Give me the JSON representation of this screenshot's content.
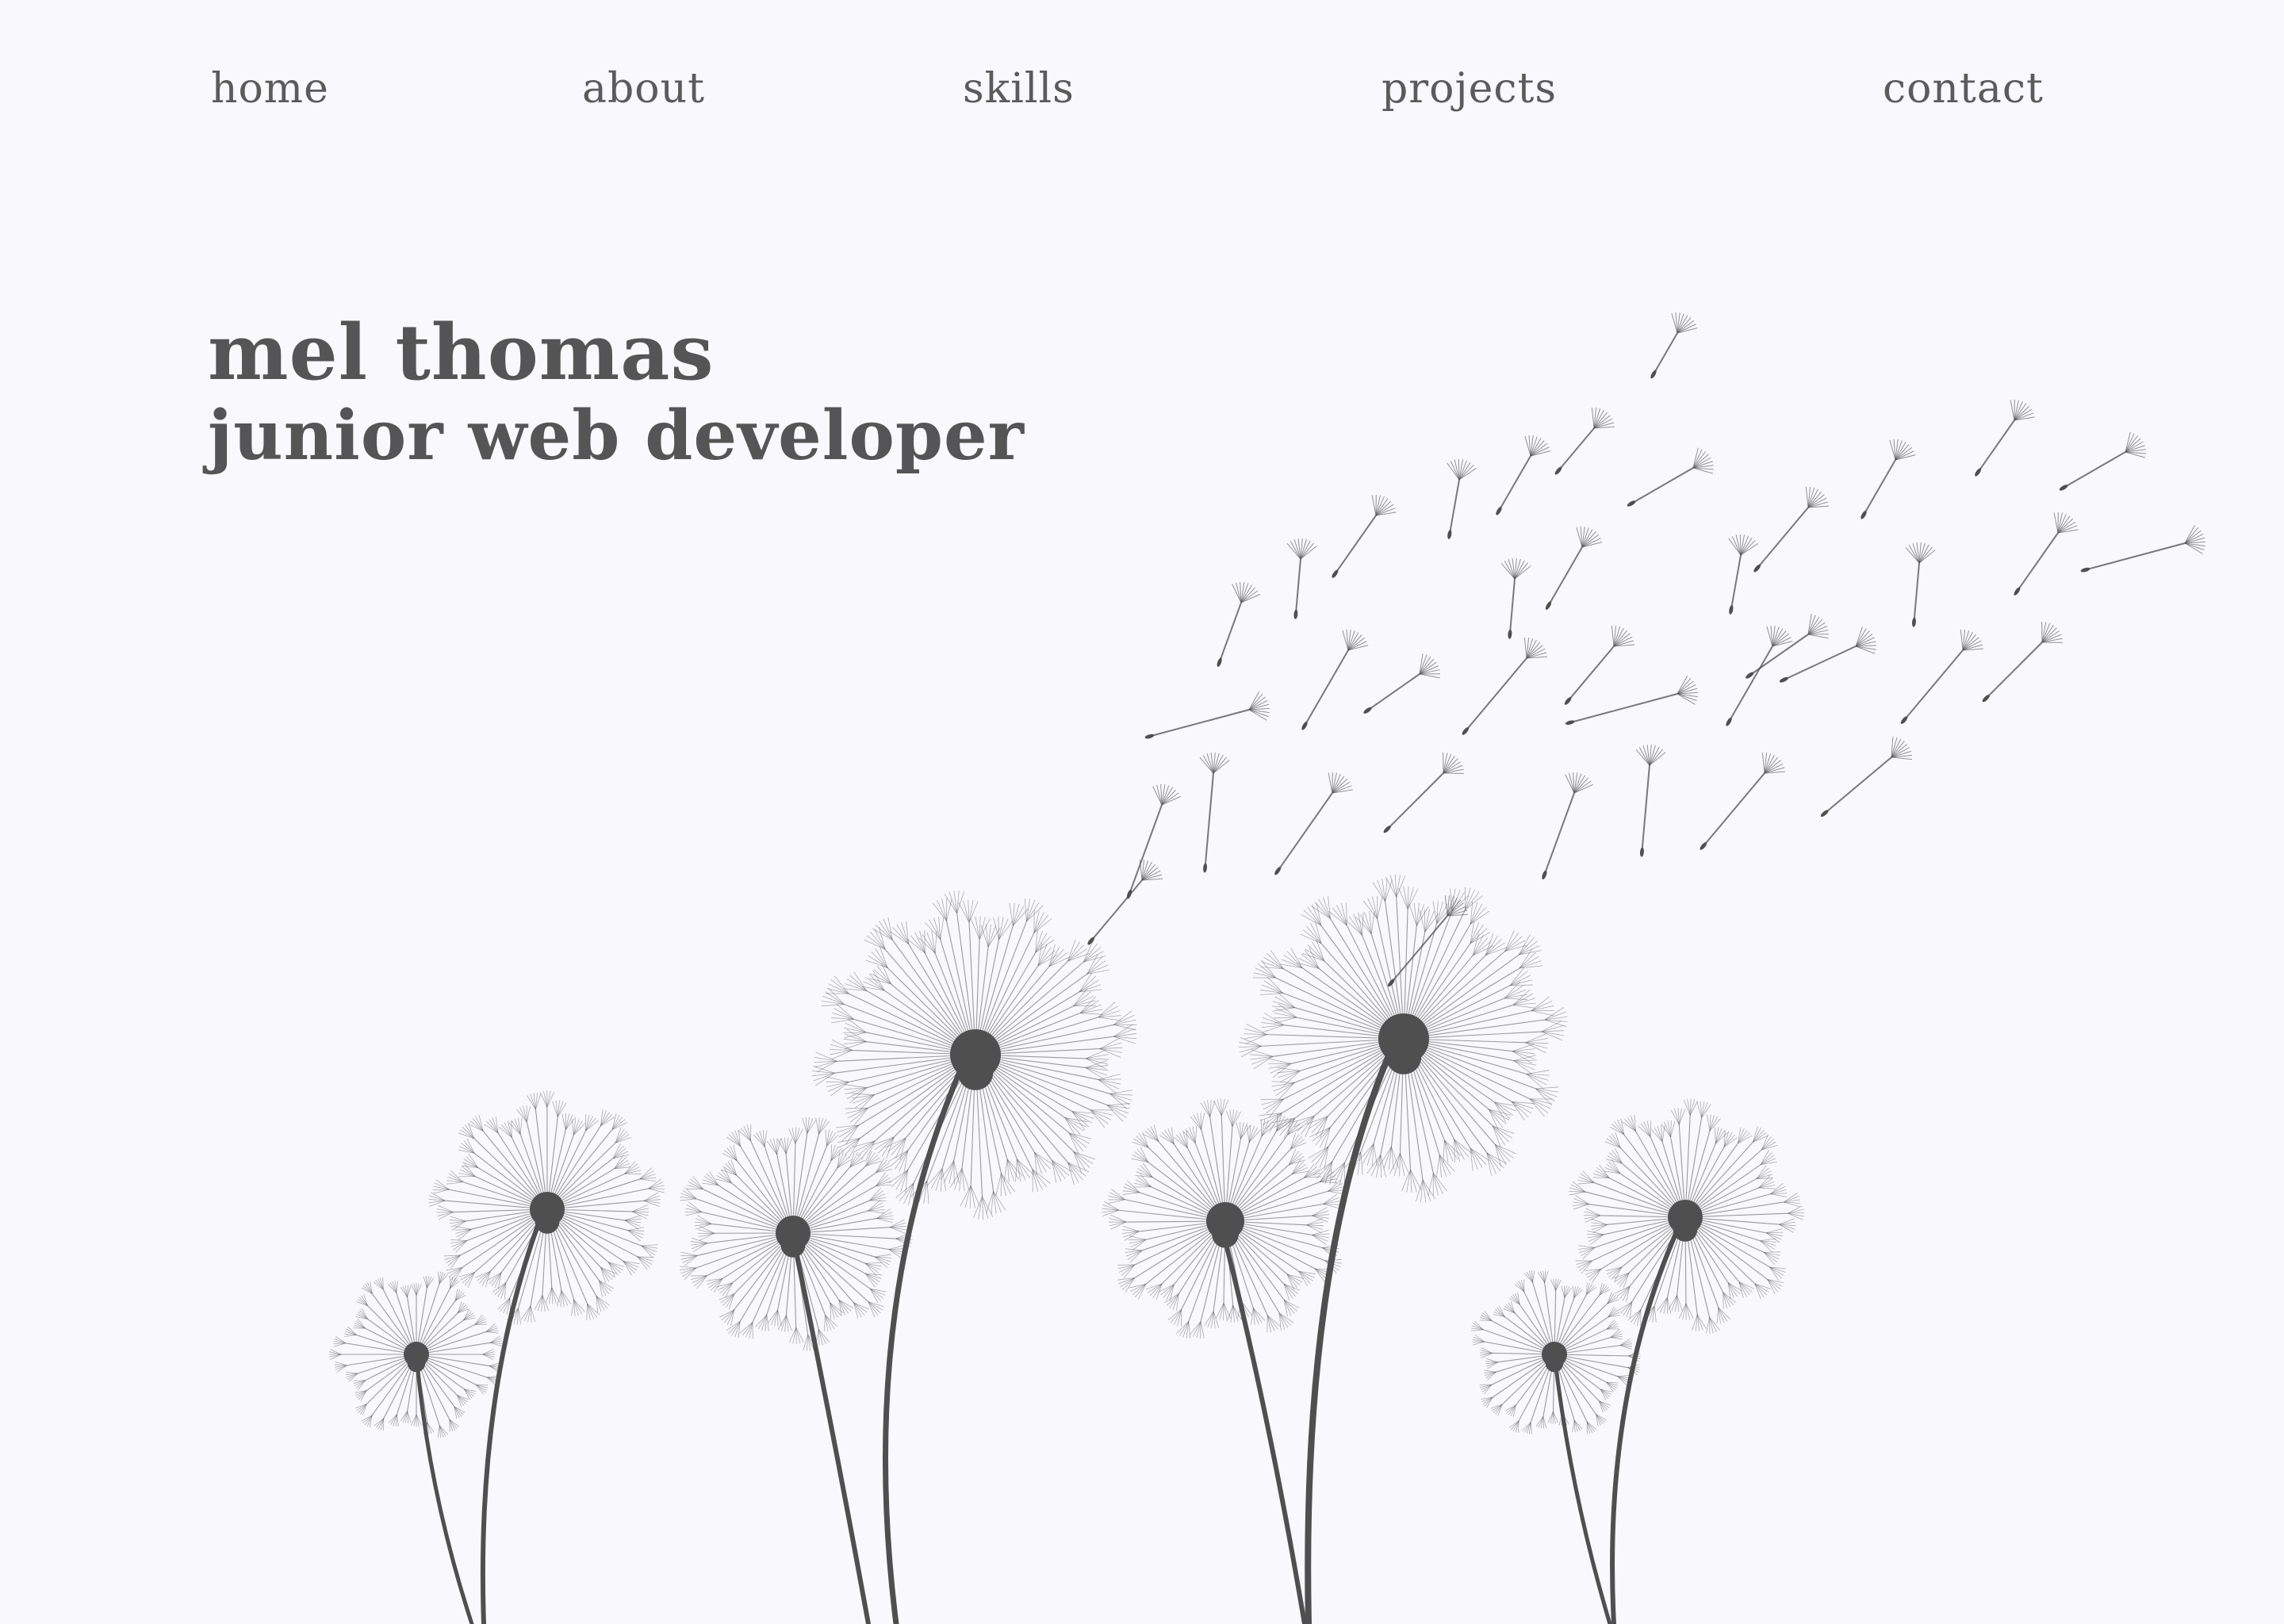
{
  "nav": {
    "items": [
      {
        "label": "home"
      },
      {
        "label": "about"
      },
      {
        "label": "skills"
      },
      {
        "label": "projects"
      },
      {
        "label": "contact"
      }
    ]
  },
  "hero": {
    "name": "mel thomas",
    "role": "junior web developer"
  },
  "colors": {
    "background": "#f8f8fd",
    "text": "#5b5b5b",
    "illustration": "#4f4f4f"
  },
  "illustration": {
    "icon": "dandelion-illustration-icon"
  }
}
